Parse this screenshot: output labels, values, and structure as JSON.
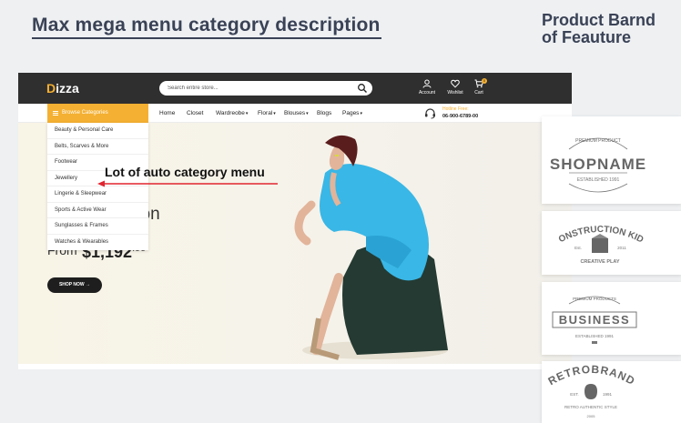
{
  "headline": "Max mega menu category description",
  "side_title": [
    "Product Barnd",
    "of Feauture"
  ],
  "site": {
    "logo": {
      "mark": "D",
      "text": "izza"
    },
    "search": {
      "placeholder": "Search entire store..."
    },
    "toplinks": [
      {
        "label": "Account",
        "icon": "user-icon"
      },
      {
        "label": "Wishlist",
        "icon": "heart-icon"
      },
      {
        "label": "Cart",
        "icon": "cart-icon",
        "badge": "0"
      }
    ],
    "browse_label": "Browse Categories",
    "nav": [
      {
        "label": "Home",
        "dropdown": false
      },
      {
        "label": "Closet",
        "dropdown": false
      },
      {
        "label": "Wardreobe",
        "dropdown": true
      },
      {
        "label": "Floral",
        "dropdown": true
      },
      {
        "label": "Blouses",
        "dropdown": true
      },
      {
        "label": "Blogs",
        "dropdown": false
      },
      {
        "label": "Pages",
        "dropdown": true
      }
    ],
    "hotline": {
      "label": "Hotline Free:",
      "number": "06-900-6789-00"
    },
    "categories": [
      "Beauty & Personal Care",
      "Belts, Scarves & More",
      "Footwear",
      "Jewellery",
      "Lingerie & Sleepwear",
      "Sports & Active Wear",
      "Sunglasses & Frames",
      "Watches & Wearables"
    ],
    "hero": {
      "title": "tion",
      "from": "From",
      "price": "$1,192",
      "cents": ".99",
      "button": "SHOP NOW"
    }
  },
  "annotation": "Lot of auto category menu",
  "brands": [
    {
      "name": "SHOPNAME",
      "top": "PREMIUM PRODUCT",
      "bottom": "ESTABLISHED 1991"
    },
    {
      "name": "CONSTRUCTION KIDS",
      "top": "",
      "bottom": "CREATIVE PLAY",
      "years": [
        "Est.",
        "2011"
      ]
    },
    {
      "name": "BUSINESS",
      "top": "PREMIUM PRODUCTS",
      "bottom": "ESTABLISHED 1991"
    },
    {
      "name": "RETROBRAND",
      "top": "",
      "bottom": "RETRO AUTHENTIC STYLE",
      "years": [
        "EST.",
        "1991"
      ],
      "extra": "2005"
    }
  ],
  "colors": {
    "accent": "#f4b032",
    "dark_bar": "#2f2f2f",
    "heading": "#3a4256",
    "arrow": "#e0242f"
  }
}
